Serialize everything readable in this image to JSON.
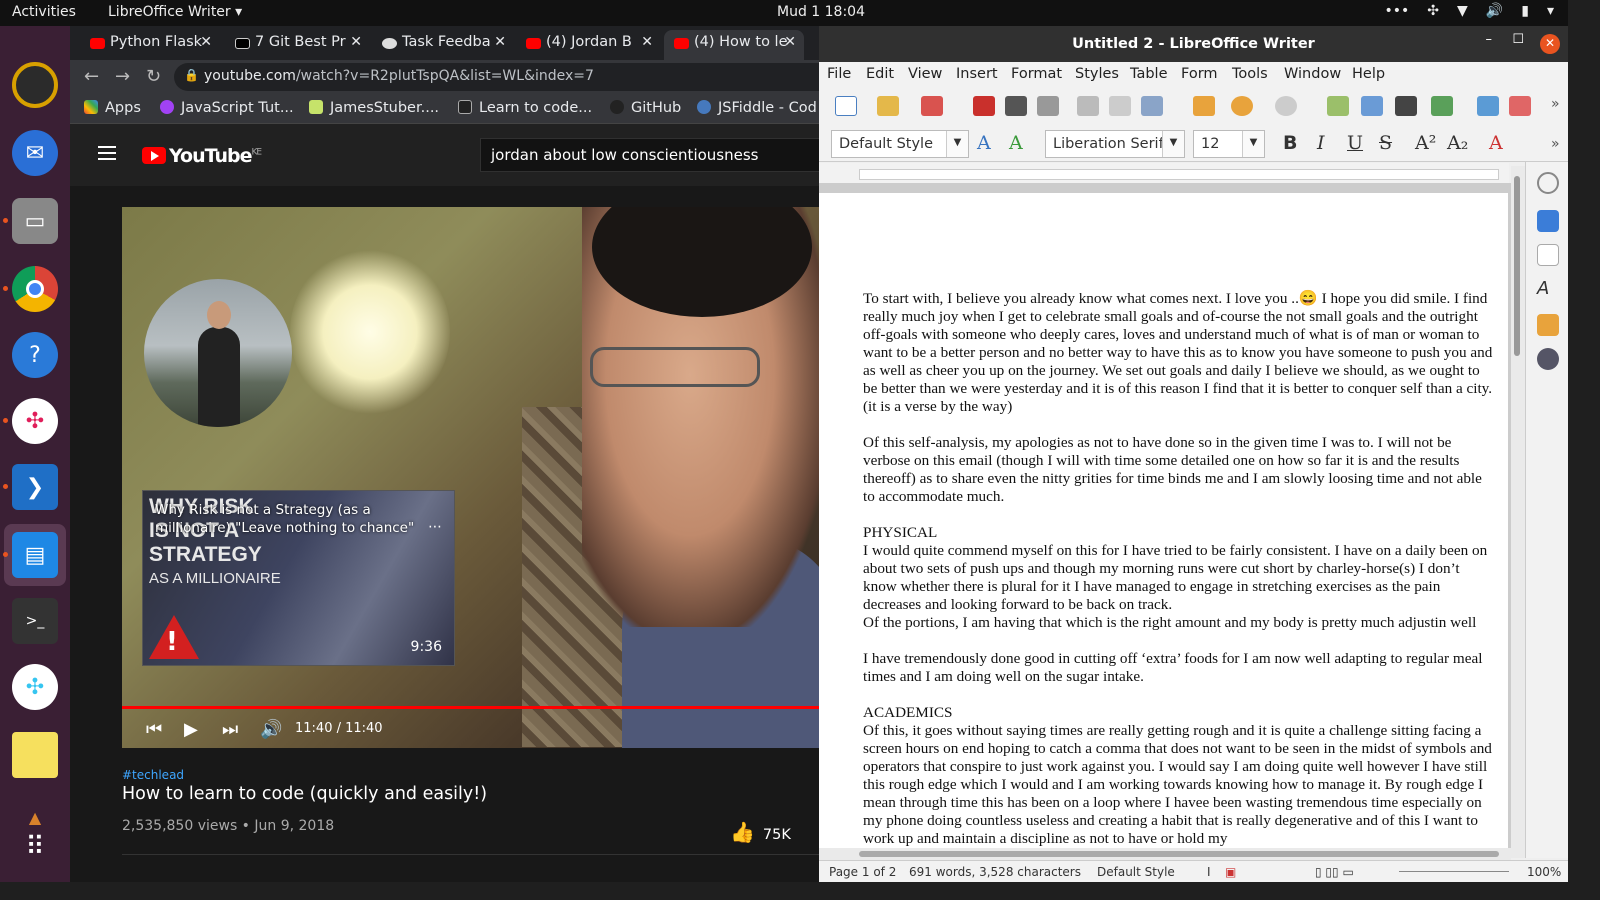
{
  "topbar": {
    "activities": "Activities",
    "app_name": "LibreOffice Writer ▾",
    "clock": "Mud 1  18:04"
  },
  "browser": {
    "tabs": [
      {
        "label": "Python Flask",
        "icon": "youtube-icon"
      },
      {
        "label": "7 Git Best Pr",
        "icon": "dev-icon"
      },
      {
        "label": "Task Feedba",
        "icon": "globe-icon"
      },
      {
        "label": "(4) Jordan B",
        "icon": "youtube-icon"
      },
      {
        "label": "(4) How to le",
        "icon": "youtube-icon",
        "active": true
      }
    ],
    "url_host": "youtube.com",
    "url_path": "/watch?v=R2pIutTspQA&list=WL&index=7",
    "bookmarks": [
      "Apps",
      "JavaScript Tut...",
      "JamesStuber....",
      "Learn to code...",
      "GitHub",
      "JSFiddle - Cod"
    ]
  },
  "youtube": {
    "logo": "YouTube",
    "region": "KE",
    "search_value": "jordan about low conscientiousness",
    "card": {
      "title": "Why Risk is not a Strategy (as a millionaire) \"Leave nothing to chance\"",
      "thumb_text_1": "WHY RISK",
      "thumb_text_2": "IS NOT A",
      "thumb_text_3": "STRATEGY",
      "thumb_text_4": "AS A MILLIONAIRE",
      "duration": "9:36"
    },
    "player_time": "11:40 / 11:40",
    "progress_fraction": 1.0,
    "hashtag": "#techlead",
    "video_title": "How to learn to code (quickly and easily!)",
    "views": "2,535,850 views • Jun 9, 2018",
    "likes": "75K"
  },
  "writer": {
    "title": "Untitled 2 - LibreOffice Writer",
    "menu": [
      "File",
      "Edit",
      "View",
      "Insert",
      "Format",
      "Styles",
      "Table",
      "Form",
      "Tools",
      "Window",
      "Help"
    ],
    "para_style": "Default Style",
    "font_name": "Liberation Serif",
    "font_size": "12",
    "paragraphs": [
      "To start with, I believe you already know what comes next. I love you ..😄 I hope you did smile. I find really much joy when I get to celebrate small goals and of-course the not small goals and the outright off-goals with someone who deeply cares, loves and understand much of what is of man or woman to want to be a better person and no better way to have this as to know you have someone to push you and as well as cheer you up on the journey. We set out goals and daily I believe we should, as we ought to be better than we were yesterday and it is of this  reason I find that it is better to conquer self than a city.(it is a verse by the way)",
      "",
      "Of this self-analysis, my apologies as not to have done so in the given time I was to. I will not be verbose on this email (though I will with time some detailed one on how so far it is and the results thereoff) as to share even the nitty grities for time binds me and I am slowly loosing time and not able to accommodate much.",
      "",
      "PHYSICAL",
      "I would quite commend myself on this for I have tried to be fairly consistent. I have on a daily been on about two sets of push ups and though my morning runs were cut short by charley-horse(s) I don’t know whether there is plural for it I have managed to engage in stretching exercises as the pain decreases and looking forward to be back on track.",
      "Of the portions, I am having that which is the right amount and my body is pretty much adjustin well",
      "",
      "I have tremendously done good in cutting off ‘extra’ foods for I am now well adapting to regular meal times and I am doing well on the sugar intake.",
      "",
      "ACADEMICS",
      "Of this, it goes without saying times are really getting rough and it is quite a challenge sitting facing a screen hours on end hoping to catch a comma that does not want to be seen in the midst of symbols and operators that conspire to just work against you. I would say I am doing quite well however I have still this rough edge which I would and I am working towards knowing how to manage it. By rough edge I mean through time this has been on a loop where I havee been wasting tremendous time especially on my phone doing countless useless and creating a habit that is really degenerative and of this I want to work up and maintain a discipline as not to have or hold my"
    ],
    "status": {
      "page": "Page 1 of 2",
      "words": "691 words, 3,528 characters",
      "style": "Default Style",
      "zoom": "100%"
    }
  }
}
